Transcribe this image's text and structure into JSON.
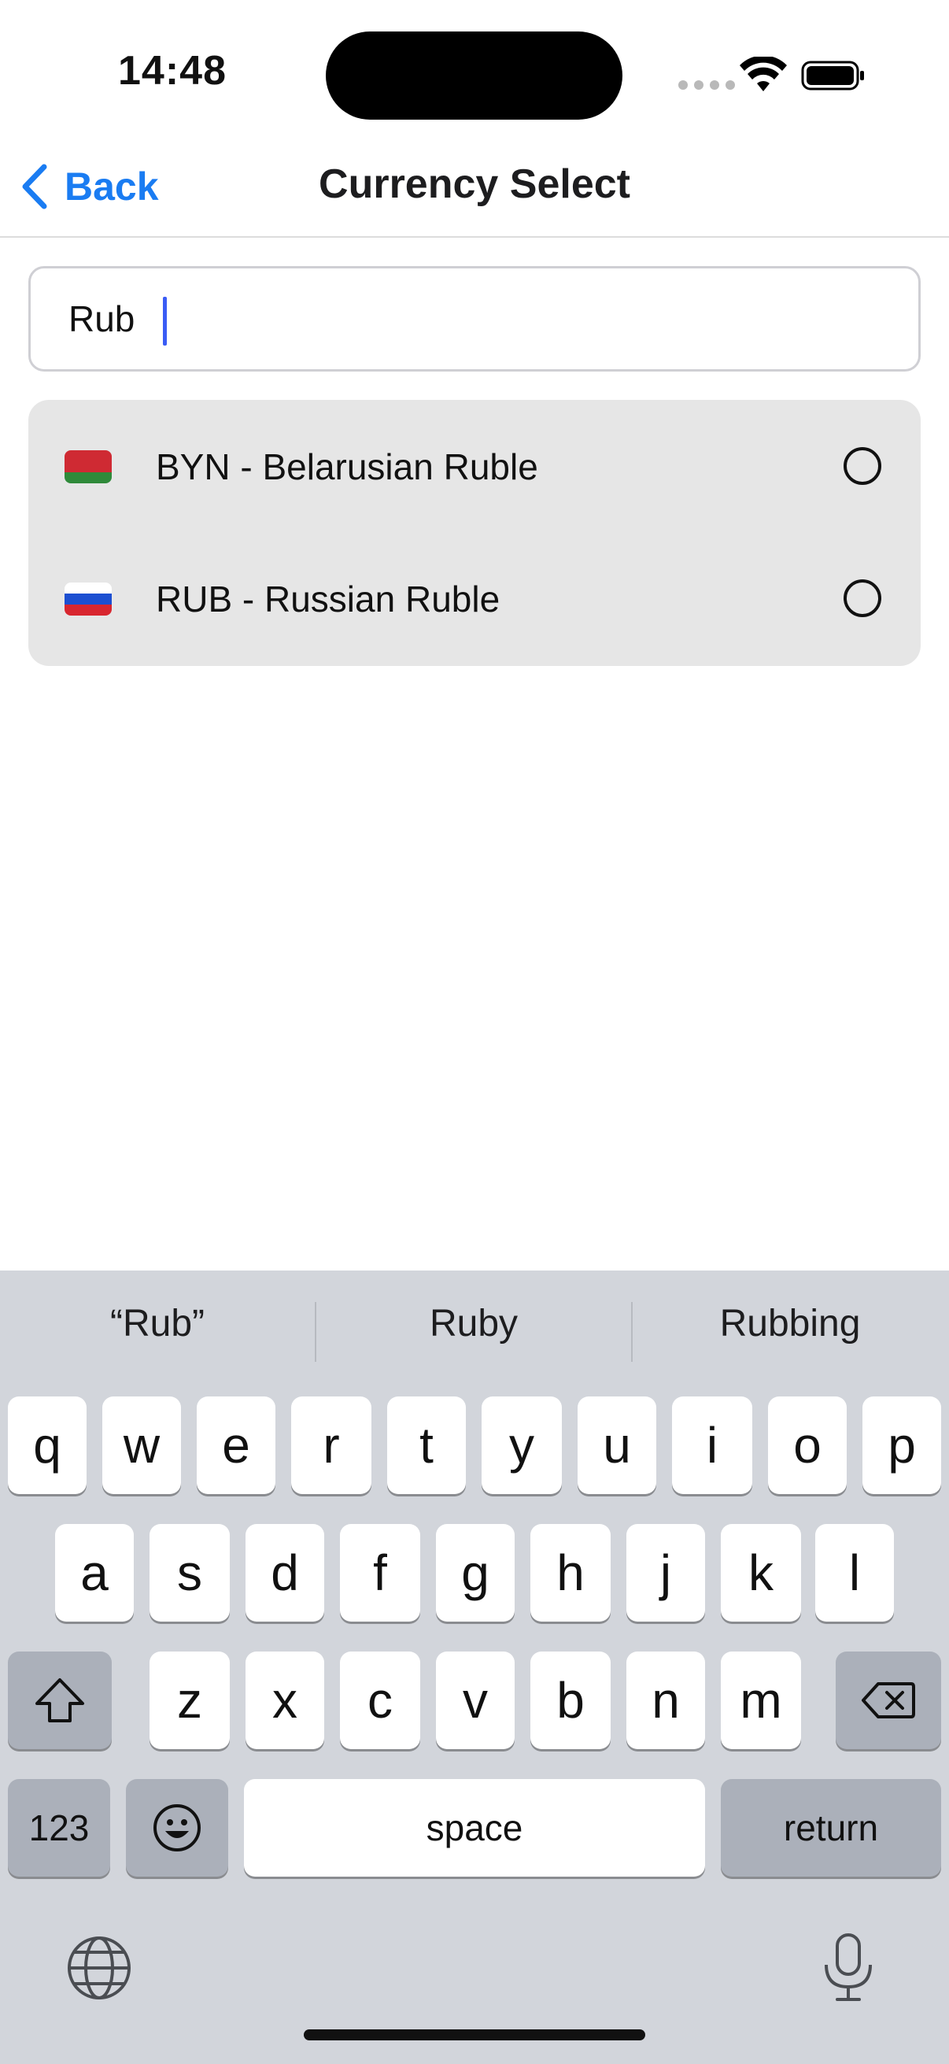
{
  "status_bar": {
    "time": "14:48"
  },
  "nav": {
    "back_label": "Back",
    "title": "Currency Select"
  },
  "search": {
    "value": "Rub",
    "placeholder": ""
  },
  "results": [
    {
      "code_label": "BYN - Belarusian Ruble",
      "flag": "belarus-flag-icon",
      "selected": false
    },
    {
      "code_label": "RUB - Russian Ruble",
      "flag": "russia-flag-icon",
      "selected": false
    }
  ],
  "keyboard": {
    "suggestions": [
      "“Rub”",
      "Ruby",
      "Rubbing"
    ],
    "row1": [
      "q",
      "w",
      "e",
      "r",
      "t",
      "y",
      "u",
      "i",
      "o",
      "p"
    ],
    "row2": [
      "a",
      "s",
      "d",
      "f",
      "g",
      "h",
      "j",
      "k",
      "l"
    ],
    "row3": [
      "z",
      "x",
      "c",
      "v",
      "b",
      "n",
      "m"
    ],
    "numbers_label": "123",
    "space_label": "space",
    "return_label": "return"
  },
  "colors": {
    "accent": "#1a7cf2",
    "list_bg": "#e6e6e6",
    "keyboard_bg": "#d2d5db"
  }
}
